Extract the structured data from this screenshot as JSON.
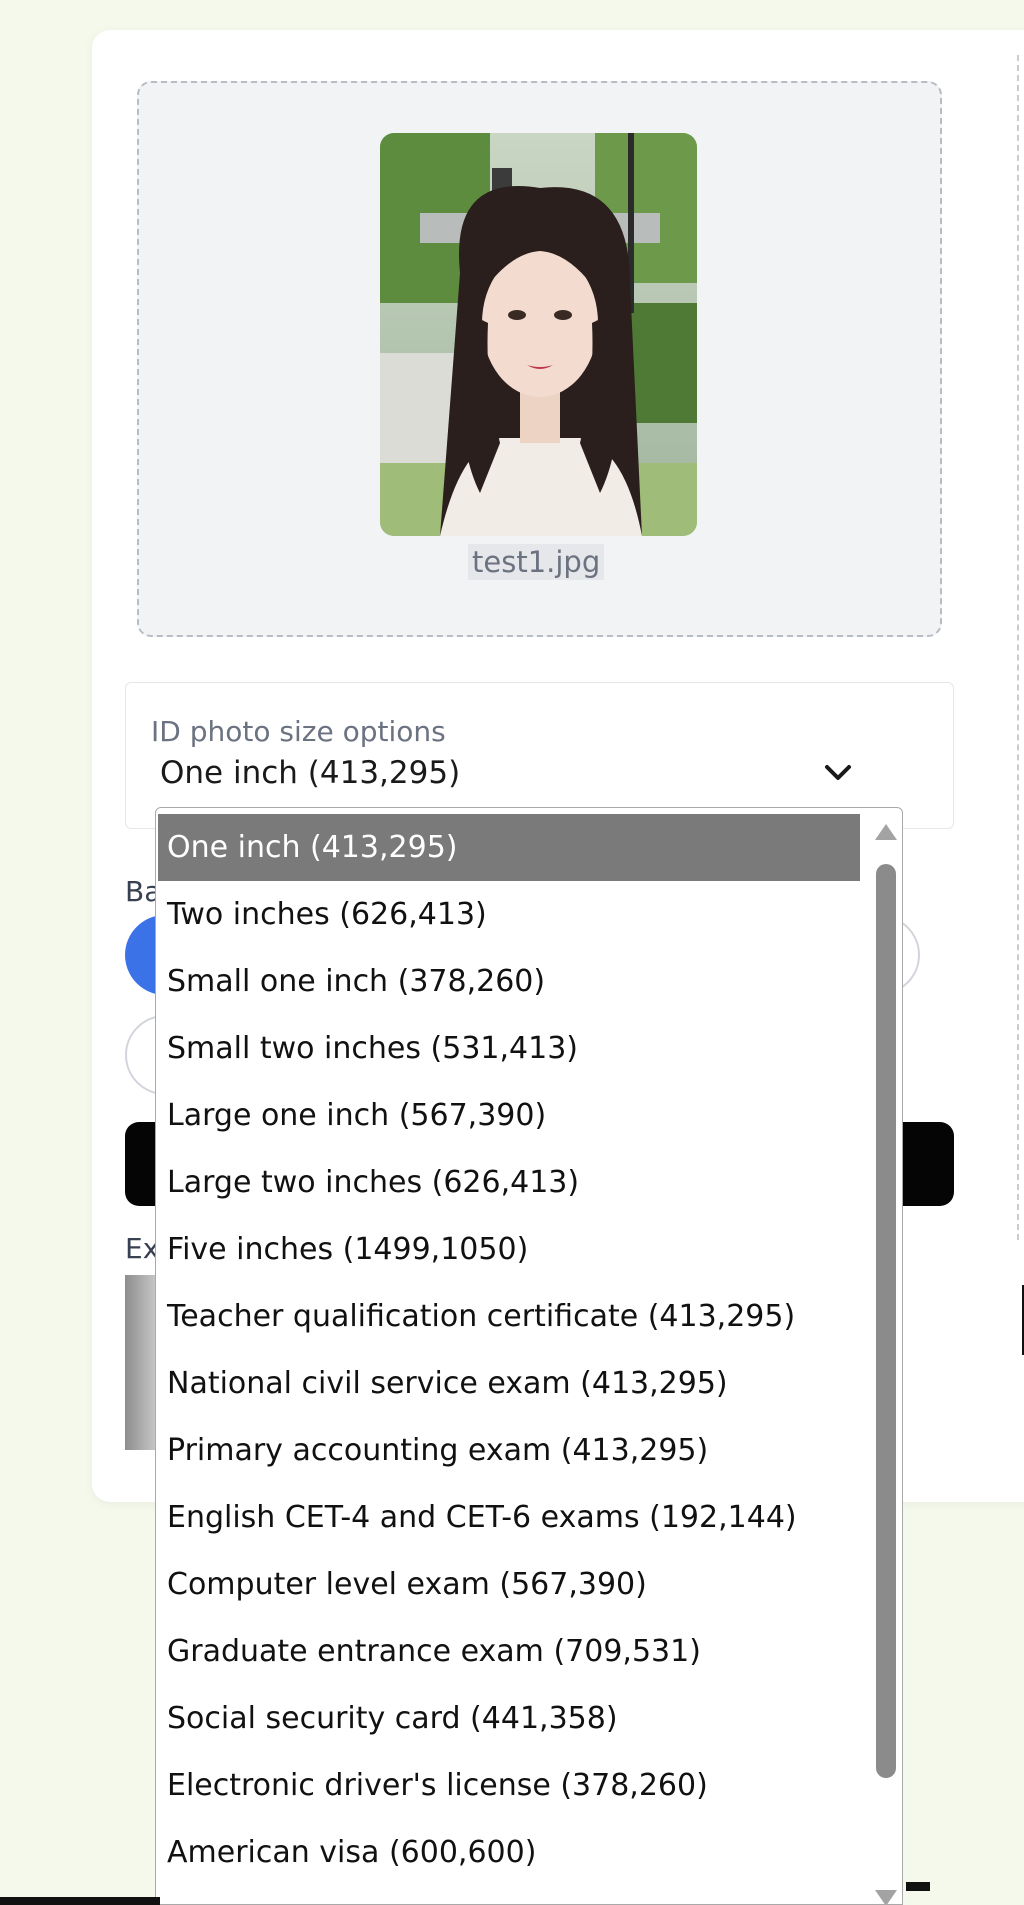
{
  "upload": {
    "filename": "test1.jpg"
  },
  "size_select": {
    "label": "ID photo size options",
    "selected": "One inch (413,295)",
    "options": [
      "One inch (413,295)",
      "Two inches (626,413)",
      "Small one inch (378,260)",
      "Small two inches (531,413)",
      "Large one inch (567,390)",
      "Large two inches (626,413)",
      "Five inches (1499,1050)",
      "Teacher qualification certificate (413,295)",
      "National civil service exam (413,295)",
      "Primary accounting exam (413,295)",
      "English CET-4 and CET-6 exams (192,144)",
      "Computer level exam (567,390)",
      "Graduate entrance exam (709,531)",
      "Social security card (441,358)",
      "Electronic driver's license (378,260)",
      "American visa (600,600)"
    ]
  },
  "partially_hidden": {
    "background_label": "Ba",
    "examples_label": "Ex"
  },
  "colors": {
    "page_bg": "#f4f9ec",
    "accent_blue": "#3b72e8",
    "selected_bg": "#7a7a7a",
    "button_black": "#050505"
  }
}
